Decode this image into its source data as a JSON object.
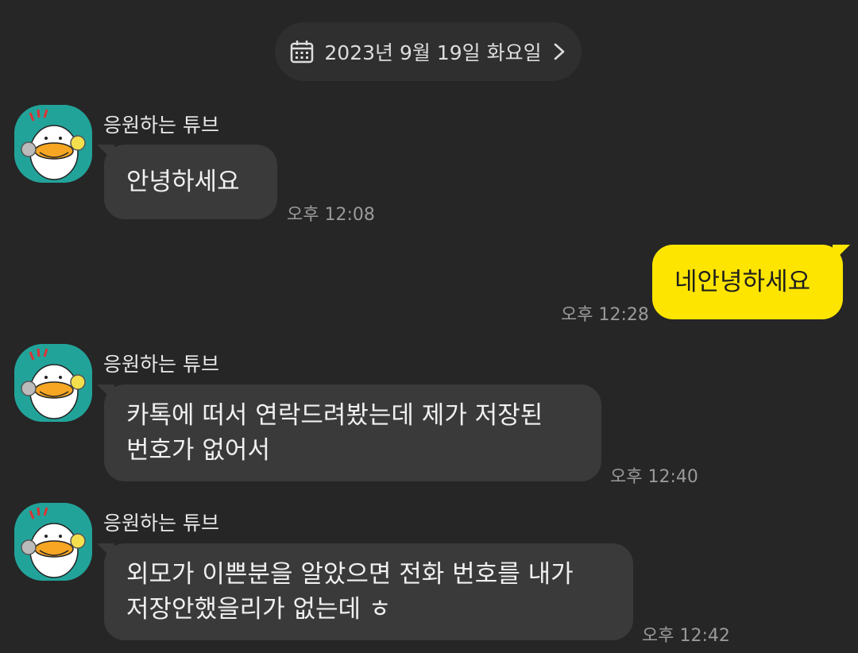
{
  "date_header": {
    "label": "2023년 9월 19일 화요일",
    "icon": "calendar-icon",
    "chevron": "chevron-right-icon"
  },
  "colors": {
    "background": "#262626",
    "bubble_received": "#3a3a3a",
    "bubble_sent": "#fee500",
    "avatar_bg": "#22a39a"
  },
  "messages": [
    {
      "sender": "응원하는 튜브",
      "text": "안녕하세요",
      "time": "오후 12:08",
      "mine": false
    },
    {
      "sender": "",
      "text": "네안녕하세요",
      "time": "오후 12:28",
      "mine": true
    },
    {
      "sender": "응원하는 튜브",
      "text": "카톡에 떠서 연락드려봤는데 제가 저장된\n번호가 없어서",
      "time": "오후 12:40",
      "mine": false
    },
    {
      "sender": "응원하는 튜브",
      "text": "외모가 이쁜분을 알았으면 전화 번호를 내가\n저장안했을리가 없는데 ㅎ",
      "time": "오후 12:42",
      "mine": false
    }
  ]
}
